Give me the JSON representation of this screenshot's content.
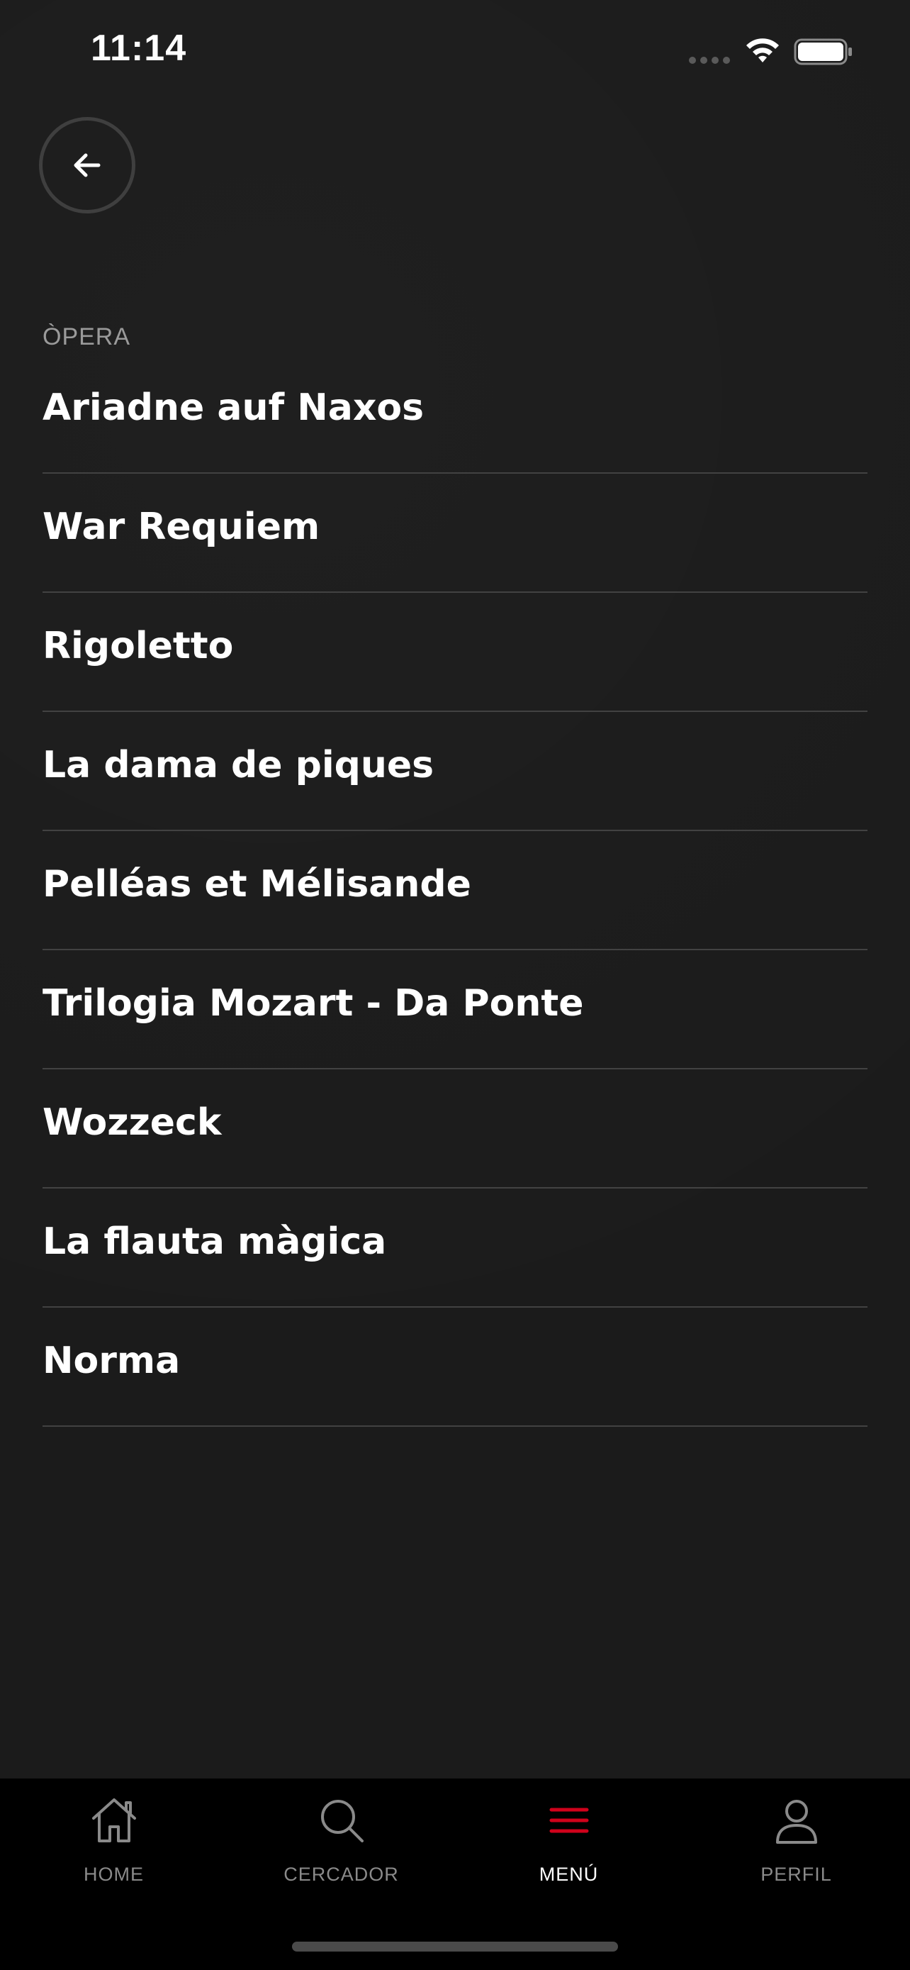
{
  "status_bar": {
    "time": "11:14"
  },
  "header": {
    "back_icon": "arrow-left-icon"
  },
  "section": {
    "label": "ÒPERA"
  },
  "list": {
    "items": [
      {
        "label": "Ariadne auf Naxos"
      },
      {
        "label": "War Requiem"
      },
      {
        "label": "Rigoletto"
      },
      {
        "label": "La dama de piques"
      },
      {
        "label": "Pelléas et Mélisande"
      },
      {
        "label": "Trilogia Mozart - Da Ponte"
      },
      {
        "label": "Wozzeck"
      },
      {
        "label": "La flauta màgica"
      },
      {
        "label": "Norma"
      }
    ]
  },
  "tab_bar": {
    "tabs": [
      {
        "label": "HOME",
        "icon": "home-icon",
        "active": false
      },
      {
        "label": "CERCADOR",
        "icon": "search-icon",
        "active": false
      },
      {
        "label": "MENÚ",
        "icon": "menu-icon",
        "active": true
      },
      {
        "label": "PERFIL",
        "icon": "user-icon",
        "active": false
      }
    ]
  },
  "colors": {
    "background": "#1b1b1b",
    "tab_bar_background": "#000000",
    "accent": "#d0021b",
    "divider": "#424242",
    "muted_text": "#9a9a9a"
  }
}
